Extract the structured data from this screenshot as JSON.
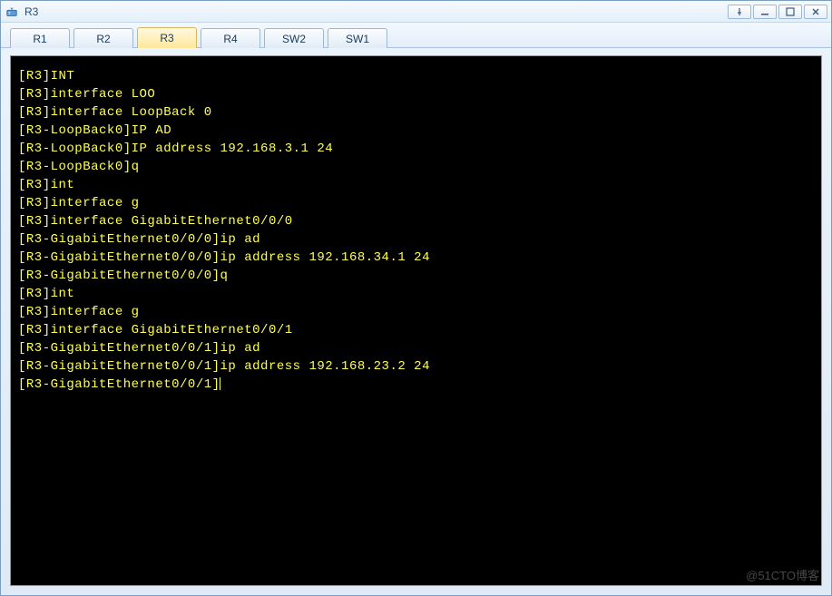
{
  "window": {
    "title": "R3"
  },
  "tabs": [
    {
      "label": "R1",
      "active": false
    },
    {
      "label": "R2",
      "active": false
    },
    {
      "label": "R3",
      "active": true
    },
    {
      "label": "R4",
      "active": false
    },
    {
      "label": "SW2",
      "active": false
    },
    {
      "label": "SW1",
      "active": false
    }
  ],
  "terminal": {
    "lines": [
      "[R3]INT",
      "[R3]interface LOO",
      "[R3]interface LoopBack 0",
      "[R3-LoopBack0]IP AD",
      "[R3-LoopBack0]IP address 192.168.3.1 24",
      "[R3-LoopBack0]q",
      "[R3]int",
      "[R3]interface g",
      "[R3]interface GigabitEthernet0/0/0",
      "[R3-GigabitEthernet0/0/0]ip ad",
      "[R3-GigabitEthernet0/0/0]ip address 192.168.34.1 24",
      "[R3-GigabitEthernet0/0/0]q",
      "[R3]int",
      "[R3]interface g",
      "[R3]interface GigabitEthernet0/0/1",
      "[R3-GigabitEthernet0/0/1]ip ad",
      "[R3-GigabitEthernet0/0/1]ip address 192.168.23.2 24",
      "[R3-GigabitEthernet0/0/1]"
    ]
  },
  "watermark": "@51CTO博客"
}
